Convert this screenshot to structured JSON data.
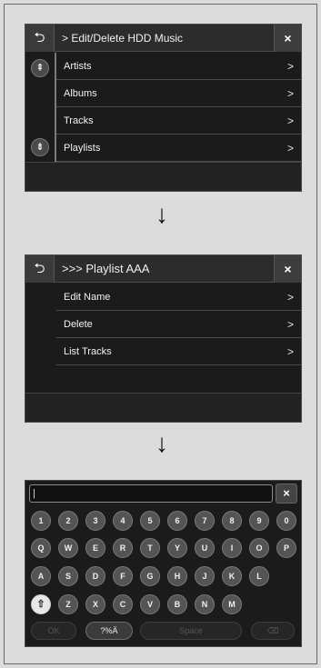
{
  "screen1": {
    "back_icon": "back-arrow-icon",
    "title": "> Edit/Delete HDD Music",
    "close_symbol": "×",
    "scroll_up_symbol": "⇞",
    "scroll_down_symbol": "⇟",
    "items": [
      {
        "label": "Artists",
        "chevron": ">"
      },
      {
        "label": "Albums",
        "chevron": ">"
      },
      {
        "label": "Tracks",
        "chevron": ">"
      },
      {
        "label": "Playlists",
        "chevron": ">"
      }
    ]
  },
  "screen2": {
    "back_icon": "back-arrow-icon",
    "title": ">>> Playlist AAA",
    "close_symbol": "×",
    "items": [
      {
        "label": "Edit Name",
        "chevron": ">"
      },
      {
        "label": "Delete",
        "chevron": ">"
      },
      {
        "label": "List Tracks",
        "chevron": ">"
      }
    ]
  },
  "arrow_symbol": "↓",
  "keyboard": {
    "input_value": "|",
    "close_symbol": "×",
    "rows": [
      [
        "1",
        "2",
        "3",
        "4",
        "5",
        "6",
        "7",
        "8",
        "9",
        "0"
      ],
      [
        "Q",
        "W",
        "E",
        "R",
        "T",
        "Y",
        "U",
        "I",
        "O",
        "P"
      ],
      [
        "A",
        "S",
        "D",
        "F",
        "G",
        "H",
        "J",
        "K",
        "L"
      ],
      [
        "⇧",
        "Z",
        "X",
        "C",
        "V",
        "B",
        "N",
        "M"
      ]
    ],
    "ok_label": "OK",
    "symbols_label": "?%Ä",
    "space_label": "Space",
    "delete_symbol": "⌫"
  },
  "colors": {
    "screen_bg": "#1b1b1b",
    "topbar_bg": "#2c2c2c",
    "key_bg": "#545454",
    "page_bg": "#dcdcdc"
  }
}
